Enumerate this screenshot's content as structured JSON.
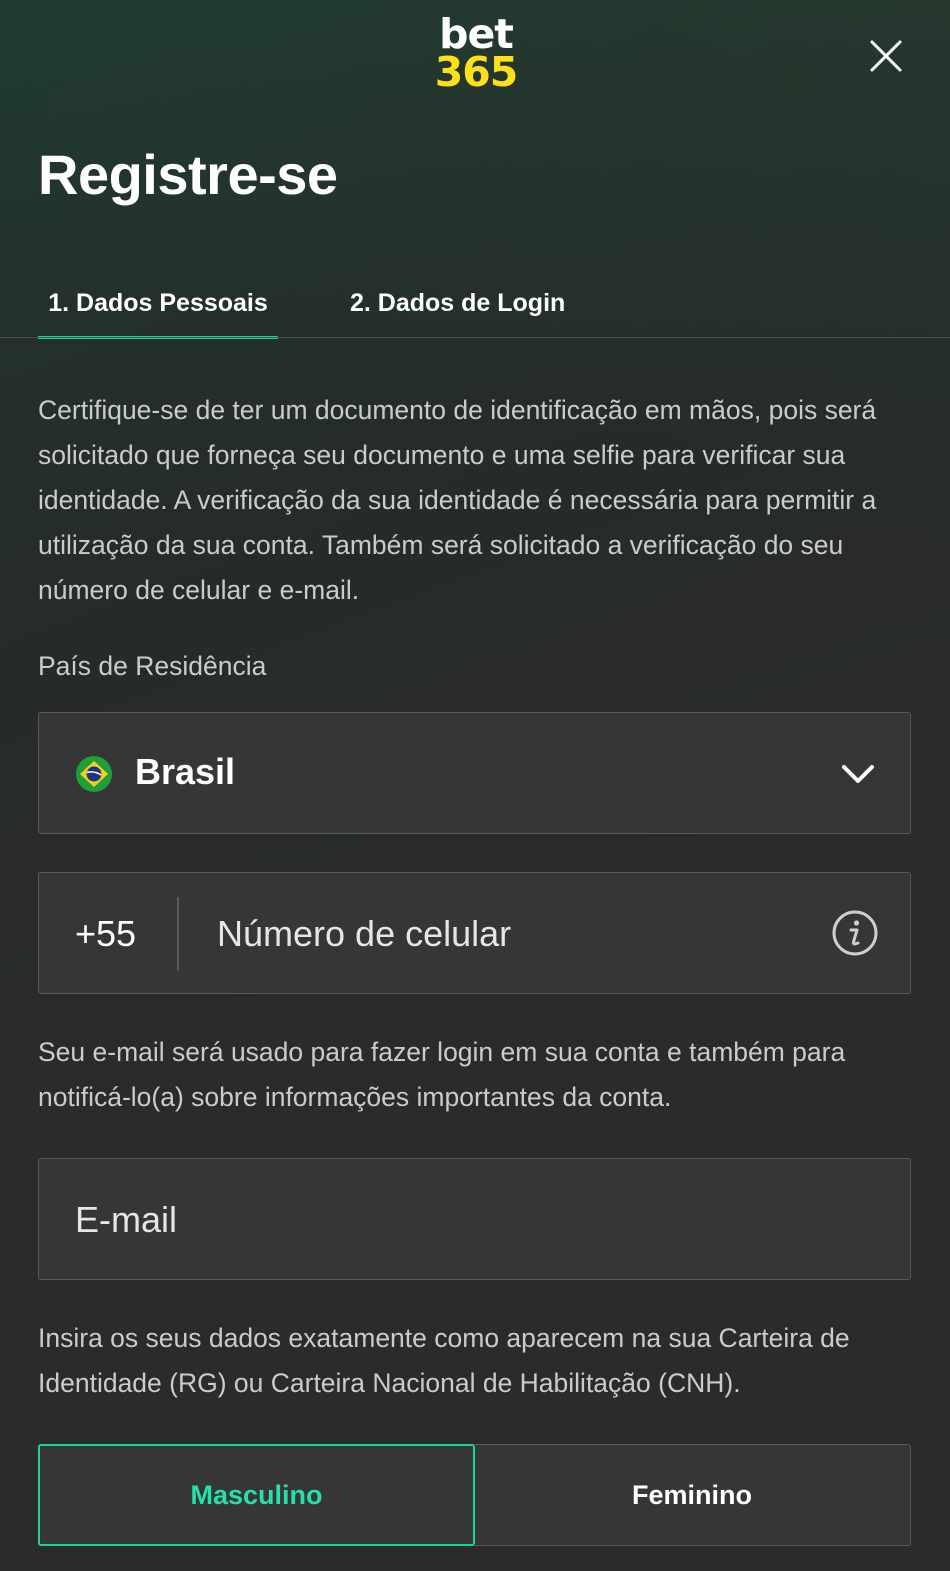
{
  "brand": {
    "logo_line1": "bet",
    "logo_line2": "365",
    "logo_accent": "#ffdf1b"
  },
  "header": {
    "title": "Registre-se",
    "close_icon": "close-icon"
  },
  "tabs": [
    {
      "label": "1.  Dados Pessoais",
      "active": true
    },
    {
      "label": "2.  Dados de Login",
      "active": false
    }
  ],
  "intro_text": "Certifique-se de ter um documento de identificação em mãos, pois será solicitado que forneça seu documento e uma selfie para verificar sua identidade. A verificação da sua identidade é necessária para permitir a utilização da sua conta. Também será solicitado a verificação do seu número de celular e e-mail.",
  "country": {
    "label": "País de Residência",
    "value": "Brasil",
    "flag_icon": "brazil-flag-icon",
    "dropdown_icon": "chevron-down-icon"
  },
  "phone": {
    "prefix": "+55",
    "placeholder": "Número de celular",
    "info_icon": "info-icon"
  },
  "email_note": "Seu e-mail será usado para fazer login em sua conta e também para notificá-lo(a) sobre informações importantes da conta.",
  "email": {
    "placeholder": "E-mail"
  },
  "document_note": "Insira os seus dados exatamente como aparecem na sua Carteira de Identidade (RG) ou Carteira Nacional de Habilitação (CNH).",
  "gender": {
    "options": [
      "Masculino",
      "Feminino"
    ],
    "selected": "Masculino"
  },
  "colors": {
    "accent": "#16d4a0",
    "background": "#2a2b2b",
    "field": "#363636"
  }
}
